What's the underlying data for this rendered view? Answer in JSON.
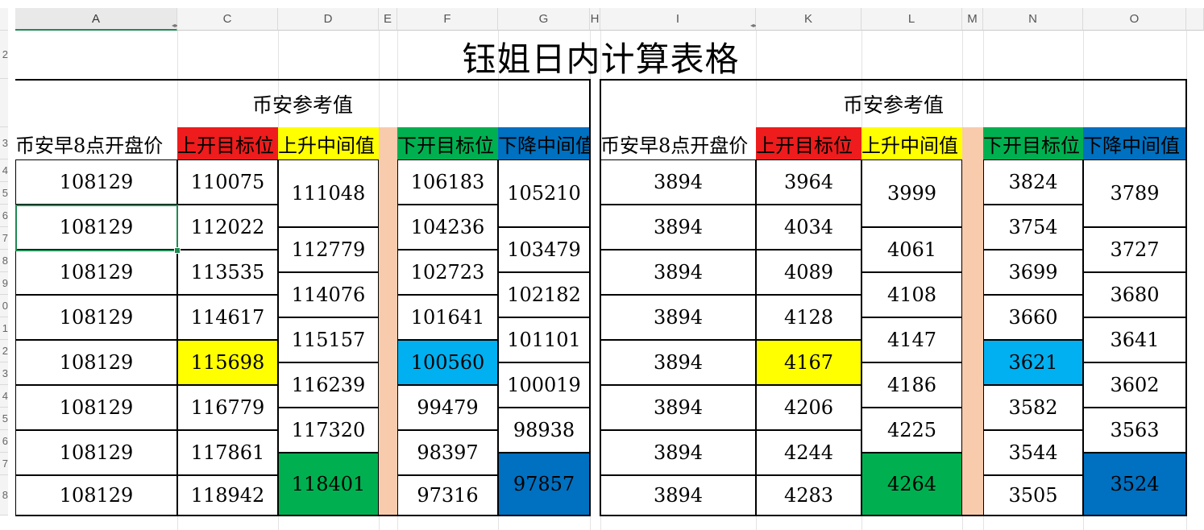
{
  "column_headers": {
    "A": "A",
    "C": "C",
    "D": "D",
    "E": "E",
    "F": "F",
    "G": "G",
    "H": "H",
    "I": "I",
    "K": "K",
    "L": "L",
    "M": "M",
    "N": "N",
    "O": "O"
  },
  "row_headers": [
    "",
    "",
    "2",
    "",
    "3",
    "4",
    "5",
    "6",
    "7",
    "8",
    "9",
    "0",
    "1",
    "2",
    "3",
    "4",
    "5",
    "6",
    "7",
    "8"
  ],
  "title": "钰姐日内计算表格",
  "left_table": {
    "section_title": "币安参考值",
    "headers": {
      "open": "币安早8点开盘价",
      "up_target": "上开目标位",
      "up_mid": "上升中间值",
      "down_target": "下开目标位",
      "down_mid": "下降中间值"
    },
    "open_values": [
      "108129",
      "108129",
      "108129",
      "108129",
      "108129",
      "108129",
      "108129",
      "108129"
    ],
    "up_target": [
      "110075",
      "112022",
      "113535",
      "114617",
      "115698",
      "116779",
      "117861",
      "118942"
    ],
    "up_mid": [
      "111048",
      "112779",
      "114076",
      "115157",
      "116239",
      "117320",
      "118401"
    ],
    "down_target": [
      "106183",
      "104236",
      "102723",
      "101641",
      "100560",
      "99479",
      "98397",
      "97316"
    ],
    "down_mid": [
      "105210",
      "103479",
      "102182",
      "101101",
      "100019",
      "98938",
      "97857"
    ]
  },
  "right_table": {
    "section_title": "币安参考值",
    "headers": {
      "open": "币安早8点开盘价",
      "up_target": "上开目标位",
      "up_mid": "上升中间值",
      "down_target": "下开目标位",
      "down_mid": "下降中间值"
    },
    "open_values": [
      "3894",
      "3894",
      "3894",
      "3894",
      "3894",
      "3894",
      "3894",
      "3894"
    ],
    "up_target": [
      "3964",
      "4034",
      "4089",
      "4128",
      "4167",
      "4206",
      "4244",
      "4283"
    ],
    "up_mid": [
      "3999",
      "4061",
      "4108",
      "4147",
      "4186",
      "4225",
      "4264"
    ],
    "down_target": [
      "3824",
      "3754",
      "3699",
      "3660",
      "3621",
      "3582",
      "3544",
      "3505"
    ],
    "down_mid": [
      "3789",
      "3727",
      "3680",
      "3641",
      "3602",
      "3563",
      "3524"
    ]
  },
  "colors": {
    "red": "#ee1c1c",
    "yellow": "#ffff00",
    "green": "#00b050",
    "blue": "#0070c0",
    "light_blue": "#00b0f0",
    "peach": "#f8cbad",
    "selection": "#1f8a52"
  }
}
